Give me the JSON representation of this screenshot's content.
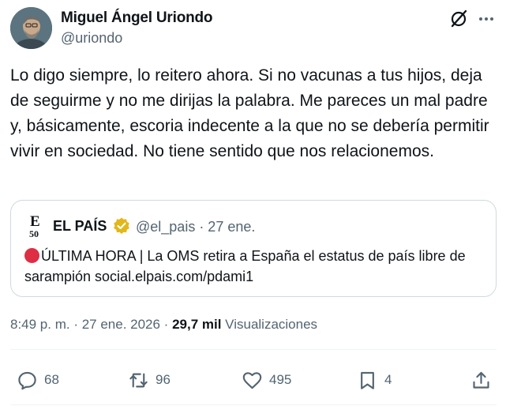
{
  "author": {
    "name": "Miguel Ángel Uriondo",
    "handle": "@uriondo"
  },
  "icons": {
    "grok": "grok-icon",
    "more": "more-icon",
    "verified": "verified-badge-icon",
    "reply": "reply-icon",
    "retweet": "retweet-icon",
    "like": "heart-icon",
    "bookmark": "bookmark-icon",
    "share": "share-icon"
  },
  "tweet": {
    "text": "Lo digo siempre, lo reitero ahora. Si no vacunas a tus hijos, deja de seguirme y no me dirijas la palabra. Me pareces un mal padre y, básicamente, escoria indecente a la que no se debería permitir vivir en sociedad. No tiene sentido que nos relacionemos."
  },
  "quote": {
    "logo_text": "E",
    "logo_sub": "50",
    "name": "EL PAÍS",
    "handle_date": "@el_pais · 27 ene.",
    "text": "ÚLTIMA HORA | La OMS retira a España el estatus de país libre de sarampión social.elpais.com/pdami1",
    "badge_color": "#e2b719"
  },
  "meta": {
    "time_date": "8:49 p. m. · 27 ene. 2026 · ",
    "views_count": "29,7 mil",
    "views_label": " Visualizaciones"
  },
  "actions": {
    "replies": "68",
    "retweets": "96",
    "likes": "495",
    "bookmarks": "4"
  },
  "colors": {
    "text_primary": "#0f1419",
    "text_secondary": "#536471",
    "border": "#cfd9de",
    "alert_red": "#dd2e44"
  }
}
